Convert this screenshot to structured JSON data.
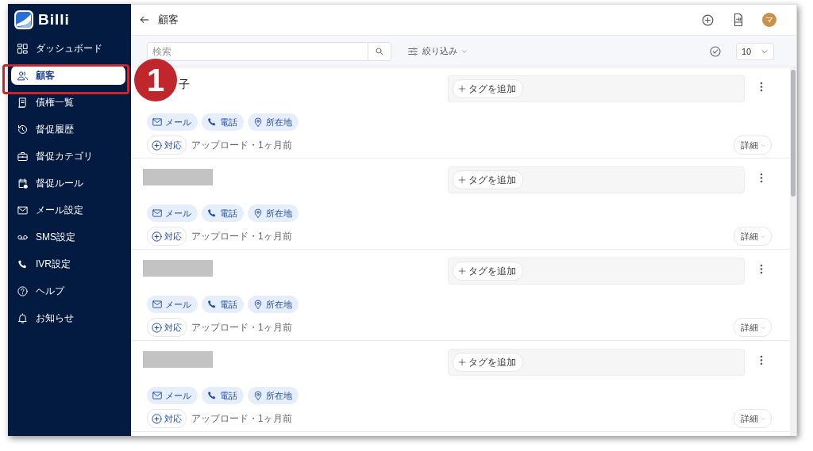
{
  "brand": {
    "name": "Billi"
  },
  "sidebar": {
    "items": [
      {
        "label": "ダッシュボード",
        "selected": false
      },
      {
        "label": "顧客",
        "selected": true
      },
      {
        "label": "債権一覧",
        "selected": false
      },
      {
        "label": "督促履歴",
        "selected": false
      },
      {
        "label": "督促カテゴリ",
        "selected": false
      },
      {
        "label": "督促ルール",
        "selected": false
      },
      {
        "label": "メール設定",
        "selected": false
      },
      {
        "label": "SMS設定",
        "selected": false
      },
      {
        "label": "IVR設定",
        "selected": false
      },
      {
        "label": "ヘルプ",
        "selected": false
      },
      {
        "label": "お知らせ",
        "selected": false
      }
    ]
  },
  "header": {
    "title": "顧客",
    "avatar": "マ"
  },
  "toolbar": {
    "search": {
      "placeholder": "検索"
    },
    "filter": "絞り込み",
    "per_page": "10"
  },
  "customers": [
    {
      "kind": "name",
      "name": "子",
      "tag_button": "タグを追加",
      "chips": [
        {
          "kind": "mail",
          "label": "メール"
        },
        {
          "kind": "phone",
          "label": "電話"
        },
        {
          "kind": "location",
          "label": "所在地"
        }
      ],
      "action": "対応",
      "meta": "アップロード・1ヶ月前",
      "details": "詳細"
    },
    {
      "kind": "redacted",
      "tag_button": "タグを追加",
      "chips": [
        {
          "kind": "mail",
          "label": "メール"
        },
        {
          "kind": "phone",
          "label": "電話"
        },
        {
          "kind": "location",
          "label": "所在地"
        }
      ],
      "action": "対応",
      "meta": "アップロード・1ヶ月前",
      "details": "詳細"
    },
    {
      "kind": "redacted",
      "tag_button": "タグを追加",
      "chips": [
        {
          "kind": "mail",
          "label": "メール"
        },
        {
          "kind": "phone",
          "label": "電話"
        },
        {
          "kind": "location",
          "label": "所在地"
        }
      ],
      "action": "対応",
      "meta": "アップロード・1ヶ月前",
      "details": "詳細"
    },
    {
      "kind": "redacted",
      "tag_button": "タグを追加",
      "chips": [
        {
          "kind": "mail",
          "label": "メール"
        },
        {
          "kind": "phone",
          "label": "電話"
        },
        {
          "kind": "location",
          "label": "所在地"
        }
      ],
      "action": "対応",
      "meta": "アップロード・1ヶ月前",
      "details": "詳細"
    }
  ],
  "annotation": {
    "number": "1"
  }
}
